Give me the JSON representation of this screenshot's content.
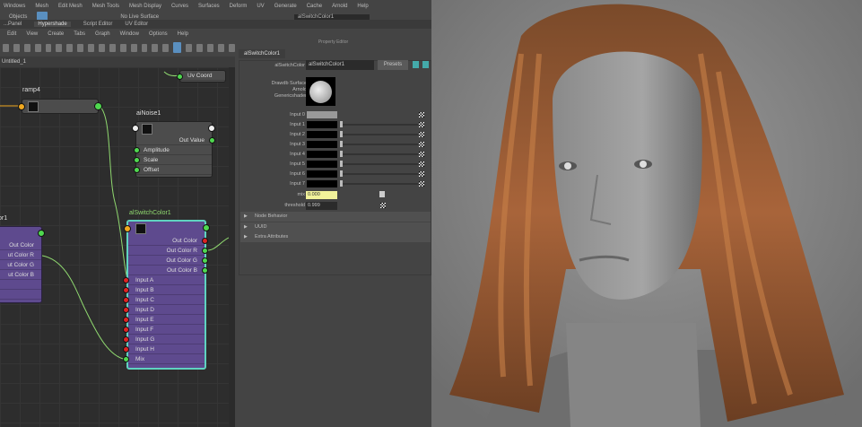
{
  "menubar": [
    "Windows",
    "Mesh",
    "Edit Mesh",
    "Mesh Tools",
    "Mesh Display",
    "Curves",
    "Surfaces",
    "Deform",
    "UV",
    "Generate",
    "Cache",
    "Arnold",
    "Help"
  ],
  "toolbar": {
    "objects": "Objects",
    "live_surface": "No Live Surface",
    "name_field": "alSwitchColor1"
  },
  "tabs": [
    "...Panel",
    "Hypershade",
    "Script Editor",
    "UV Editor"
  ],
  "hs_menu": [
    "Edit",
    "View",
    "Create",
    "Tabs",
    "Graph",
    "Window",
    "Options",
    "Help"
  ],
  "graph_tab": "Untitled_1",
  "nodes": {
    "uvcoord": "Uv Coord",
    "ramp": "ramp4",
    "noise": {
      "title": "aiNoise1",
      "rows": [
        "Out Value",
        "Amplitude",
        "Scale",
        "Offset"
      ]
    },
    "left": {
      "title": "or1",
      "rows": [
        "Out Color",
        "ut Color R",
        "ut Color G",
        "ut Color B"
      ]
    },
    "switch": {
      "title": "alSwitchColor1",
      "outs": [
        "Out Color",
        "Out Color R",
        "Out Color G",
        "Out Color B"
      ],
      "ins": [
        "Input A",
        "Input B",
        "Input C",
        "Input D",
        "Input E",
        "Input F",
        "Input G",
        "Input H",
        "Mix"
      ]
    }
  },
  "property_editor": {
    "title": "Property Editor",
    "tab": "alSwitchColor1",
    "type_label": "alSwitchColor",
    "name_value": "alSwitchColor1",
    "presets": "Presets",
    "swatch_label": "Drawdb Surface Arnold Genericshader",
    "inputs": [
      "Input 0",
      "Input 1",
      "Input 2",
      "Input 3",
      "Input 4",
      "Input 5",
      "Input 6",
      "Input 7"
    ],
    "mix_label": "mix",
    "mix_value": "0.000",
    "threshold_label": "threshold",
    "threshold_value": "0.999",
    "sections": [
      "Node Behavior",
      "UUID",
      "Extra Attributes"
    ]
  }
}
